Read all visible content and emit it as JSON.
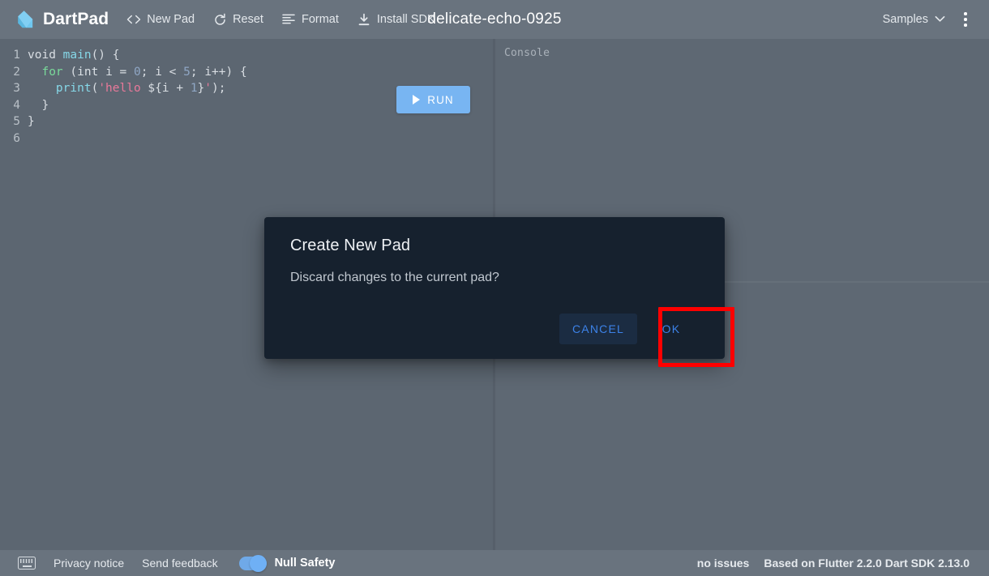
{
  "app": {
    "name": "DartPad"
  },
  "header": {
    "brand": "DartPad",
    "pad_title": "delicate-echo-0925",
    "buttons": [
      {
        "label": "New Pad",
        "icon": "code-brackets-icon"
      },
      {
        "label": "Reset",
        "icon": "refresh-icon"
      },
      {
        "label": "Format",
        "icon": "format-align-icon"
      },
      {
        "label": "Install SDK",
        "icon": "download-icon"
      }
    ],
    "samples_label": "Samples",
    "samples_icon": "chevron-down-icon",
    "more_icon": "kebab-menu-icon"
  },
  "editor": {
    "run_label": "RUN",
    "run_icon": "play-icon",
    "lines": [
      {
        "n": "1",
        "tokens": [
          {
            "t": "void",
            "c": "k-void"
          },
          {
            "t": " ",
            "c": "k-plain"
          },
          {
            "t": "main",
            "c": "k-fn"
          },
          {
            "t": "() {",
            "c": "k-punct"
          }
        ]
      },
      {
        "n": "2",
        "tokens": [
          {
            "t": "  ",
            "c": "k-plain"
          },
          {
            "t": "for",
            "c": "k-kw"
          },
          {
            "t": " (",
            "c": "k-punct"
          },
          {
            "t": "int",
            "c": "k-type"
          },
          {
            "t": " i = ",
            "c": "k-plain"
          },
          {
            "t": "0",
            "c": "k-num"
          },
          {
            "t": "; i < ",
            "c": "k-plain"
          },
          {
            "t": "5",
            "c": "k-num"
          },
          {
            "t": "; i++) {",
            "c": "k-plain"
          }
        ]
      },
      {
        "n": "3",
        "tokens": [
          {
            "t": "    ",
            "c": "k-plain"
          },
          {
            "t": "print",
            "c": "k-fn"
          },
          {
            "t": "(",
            "c": "k-punct"
          },
          {
            "t": "'hello ",
            "c": "k-str"
          },
          {
            "t": "${i + ",
            "c": "k-plain"
          },
          {
            "t": "1",
            "c": "k-num"
          },
          {
            "t": "}",
            "c": "k-plain"
          },
          {
            "t": "'",
            "c": "k-str"
          },
          {
            "t": ");",
            "c": "k-punct"
          }
        ]
      },
      {
        "n": "4",
        "tokens": [
          {
            "t": "  }",
            "c": "k-punct"
          }
        ]
      },
      {
        "n": "5",
        "tokens": [
          {
            "t": "}",
            "c": "k-punct"
          }
        ]
      },
      {
        "n": "6",
        "tokens": [
          {
            "t": "",
            "c": "k-plain"
          }
        ]
      }
    ]
  },
  "console": {
    "label": "Console",
    "output": ""
  },
  "dialog": {
    "title": "Create New Pad",
    "message": "Discard changes to the current pad?",
    "cancel_label": "CANCEL",
    "ok_label": "OK"
  },
  "footer": {
    "keyboard_icon": "keyboard-icon",
    "privacy_label": "Privacy notice",
    "feedback_label": "Send feedback",
    "null_safety_label": "Null Safety",
    "null_safety_on": true,
    "issues_label": "no issues",
    "version_label": "Based on Flutter 2.2.0 Dart SDK 2.13.0"
  },
  "colors": {
    "header_bg": "#69737e",
    "editor_bg": "#5c6671",
    "console_bg": "#5e6873",
    "dialog_bg": "#16212e",
    "accent_blue": "#78b5f2",
    "dialog_action_blue": "#3c82e8",
    "highlight_red": "#fe0000"
  }
}
